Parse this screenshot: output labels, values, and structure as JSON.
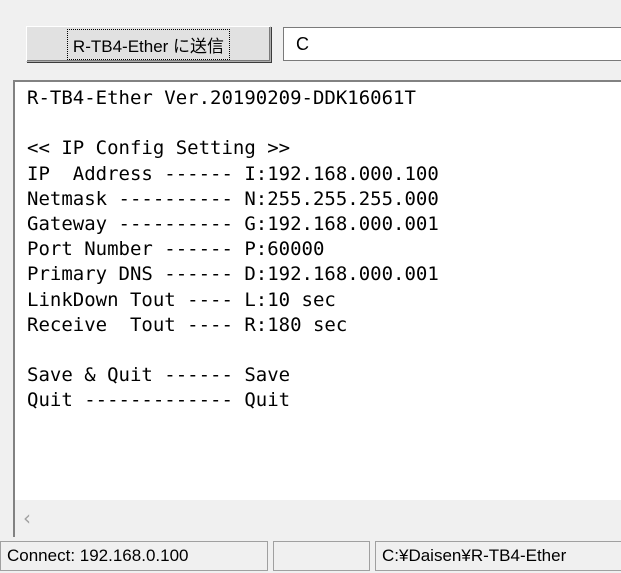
{
  "toolbar": {
    "send_button_label": "R-TB4-Ether に送信",
    "command_input_value": "C"
  },
  "terminal": {
    "lines": [
      "R-TB4-Ether Ver.20190209-DDK16061T",
      "",
      "<< IP Config Setting >>",
      "IP  Address ------ I:192.168.000.100",
      "Netmask ---------- N:255.255.255.000",
      "Gateway ---------- G:192.168.000.001",
      "Port Number ------ P:60000",
      "Primary DNS ------ D:192.168.000.001",
      "LinkDown Tout ---- L:10 sec",
      "Receive  Tout ---- R:180 sec",
      "",
      "Save & Quit ------ Save",
      "Quit ------------- Quit"
    ]
  },
  "scrollbar": {
    "left_arrow_icon": "chevron-left-icon",
    "left_arrow_glyph": "‹"
  },
  "statusbar": {
    "connection": "Connect: 192.168.0.100",
    "middle": "",
    "path": "C:¥Daisen¥R-TB4-Ether"
  }
}
